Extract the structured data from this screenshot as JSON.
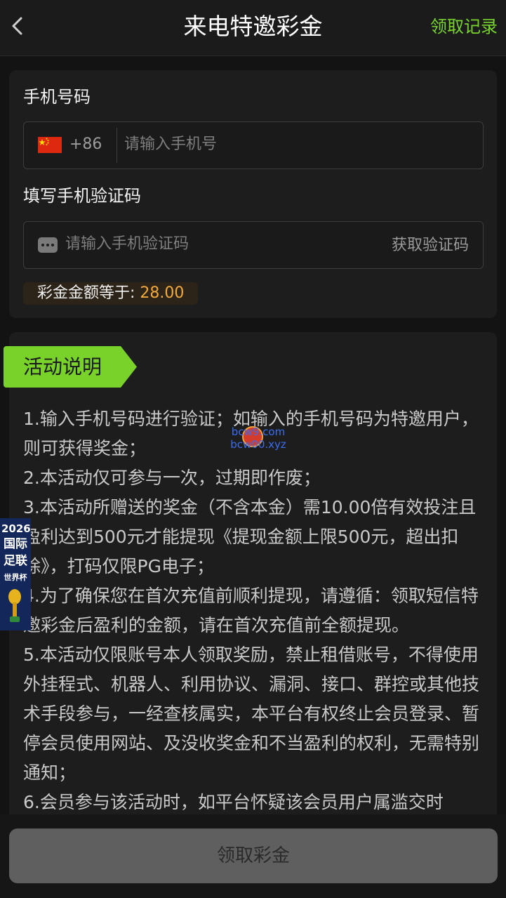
{
  "header": {
    "title": "来电特邀彩金",
    "records_link": "领取记录"
  },
  "form": {
    "phone_label": "手机号码",
    "country_code": "+86",
    "phone_placeholder": "请输入手机号",
    "verify_label": "填写手机验证码",
    "code_placeholder": "请输入手机验证码",
    "get_code_label": "获取验证码",
    "amount_label": "彩金金额等于:",
    "amount_value": "28.00"
  },
  "activity": {
    "ribbon_label": "活动说明",
    "rules": [
      "1.输入手机号码进行验证；如输入的手机号码为特邀用户，则可获得奖金；",
      "2.本活动仅可参与一次，过期即作废；",
      "3.本活动所赠送的奖金（不含本金）需10.00倍有效投注且盈利达到500元才能提现《提现金额上限500元，超出扣除》，打码仅限PG电子；",
      "4.为了确保您在首次充值前顺利提现，请遵循：领取短信特邀彩金后盈利的金额，请在首次充值前全额提现。",
      "5.本活动仅限账号本人领取奖励，禁止租借账号，不得使用外挂程式、机器人、利用协议、漏洞、接口、群控或其他技术手段参与，一经查核属实，本平台有权终止会员登录、暂停会员使用网站、及没收奖金和不当盈利的权利，无需特别通知；",
      "6.会员参与该活动时，如平台怀疑该会员用户属滥交时"
    ]
  },
  "claim_button": "领取彩金",
  "promo_badge": {
    "year": "2026",
    "line1": "国际",
    "line2": "足联",
    "line3": "世界杯"
  },
  "watermark": {
    "line1": "bcw9.com",
    "line2": "bcw00.xyz"
  },
  "colors": {
    "accent_green": "#79d52e",
    "amount_orange": "#f2a93b",
    "background": "#131313",
    "card": "#1d1d1d"
  }
}
